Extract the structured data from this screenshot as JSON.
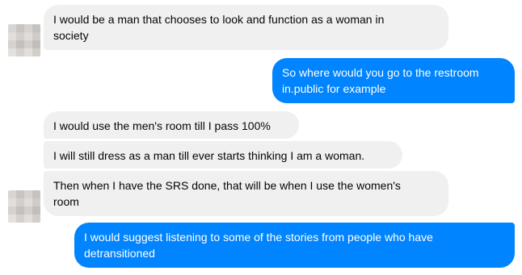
{
  "conversation": {
    "messages": [
      {
        "sender": "contact",
        "lines": [
          "I would be a man that chooses to look and function as a woman in",
          "society"
        ]
      },
      {
        "sender": "me",
        "lines": [
          "So where would you go to the restroom",
          "in.public for example"
        ]
      },
      {
        "sender": "contact",
        "lines": [
          "I would use the men's room till I pass 100%"
        ]
      },
      {
        "sender": "contact",
        "lines": [
          "I will still dress as a man till ever starts thinking I am a woman."
        ]
      },
      {
        "sender": "contact",
        "lines": [
          "Then when I have the SRS done, that will be when I use the women's",
          "room"
        ]
      },
      {
        "sender": "me",
        "lines": [
          "I would suggest listening to some of the stories from people who have",
          "detransitioned"
        ]
      }
    ]
  },
  "colors": {
    "incoming_bubble": "#f0f0f0",
    "outgoing_bubble": "#0084ff",
    "incoming_text": "#050505",
    "outgoing_text": "#ffffff"
  }
}
